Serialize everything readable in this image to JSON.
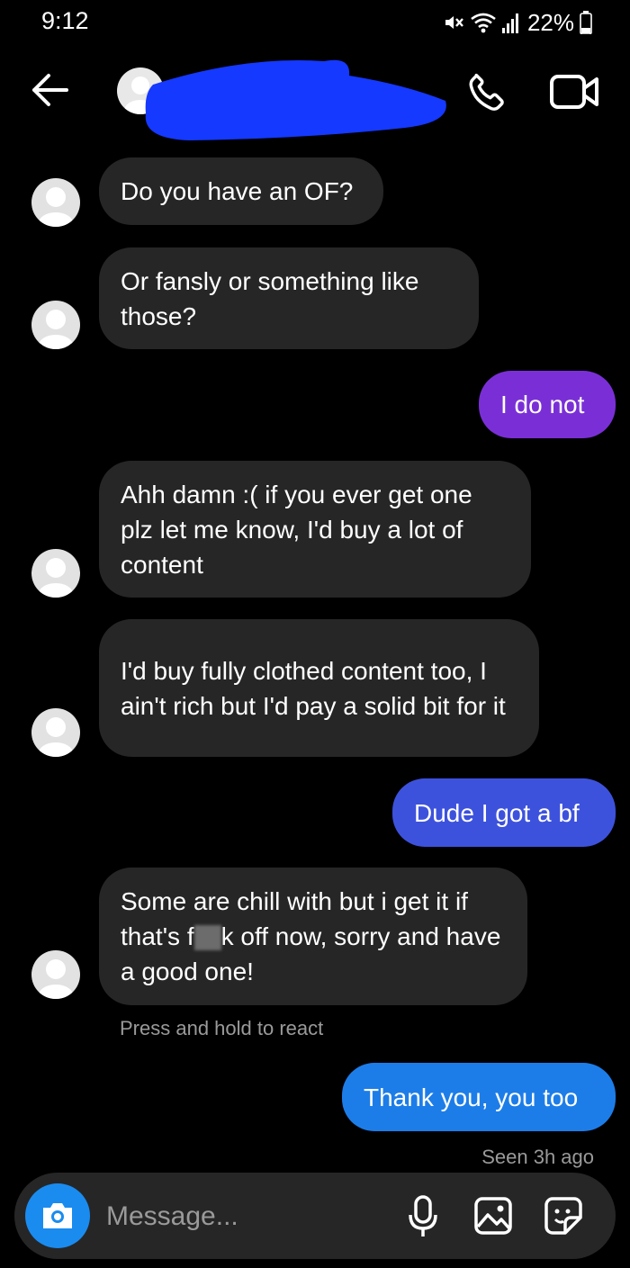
{
  "status_bar": {
    "time": "9:12",
    "battery": "22%",
    "icons": [
      "mute-icon",
      "wifi-icon",
      "signal-icon",
      "battery-icon"
    ]
  },
  "header": {
    "icons": [
      "back-arrow-icon",
      "phone-icon",
      "video-camera-icon"
    ]
  },
  "messages": [
    {
      "sender": "them",
      "text": "Do you have an OF?"
    },
    {
      "sender": "them",
      "text": "Or fansly or something like those?"
    },
    {
      "sender": "me",
      "text": "I do not",
      "color": "#7a2fd6"
    },
    {
      "sender": "them",
      "text": "Ahh damn :( if you ever get one plz let me know, I'd buy a lot of content"
    },
    {
      "sender": "them",
      "text": "I'd buy fully clothed content too, I ain't rich but I'd pay a solid bit for it"
    },
    {
      "sender": "me",
      "text": "Dude I got a bf",
      "color": "#3d52dc"
    },
    {
      "sender": "them",
      "text_before": "Some are chill with but i get it if that's f",
      "text_after": "k off now, sorry and have a good one!"
    },
    {
      "sender": "me",
      "text": "Thank you, you too",
      "color": "#1d7de8"
    }
  ],
  "react_hint": "Press and hold to react",
  "seen_status": "Seen 3h ago",
  "composer": {
    "placeholder": "Message...",
    "icons": [
      "camera-icon",
      "microphone-icon",
      "gallery-icon",
      "sticker-icon"
    ]
  },
  "colors": {
    "background": "#000000",
    "incoming_bubble": "#262626",
    "camera_button": "#1a8cf0",
    "redaction": "#1539ff"
  }
}
